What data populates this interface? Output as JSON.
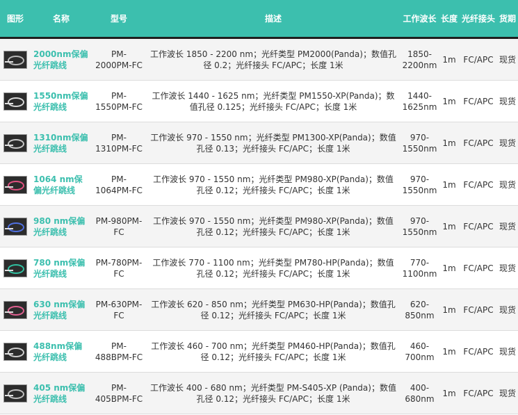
{
  "header": {
    "image": "图形",
    "name": "名称",
    "model": "型号",
    "desc": "描述",
    "wavelength": "工作波长",
    "length": "长度",
    "connector": "光纤接头",
    "stock": "货期"
  },
  "rows": [
    {
      "name": "2000nm保偏光纤跳线",
      "model": "PM-2000PM-FC",
      "desc": "工作波长 1850 - 2200 nm；光纤类型 PM2000(Panda)；数值孔径 0.2；光纤接头 FC/APC；长度 1米",
      "wavelength": "1850-2200nm",
      "length": "1m",
      "connector": "FC/APC",
      "stock": "现货",
      "fiber_color": "#b8b8b8"
    },
    {
      "name": "1550nm保偏光纤跳线",
      "model": "PM-1550PM-FC",
      "desc": "工作波长 1440 - 1625 nm；光纤类型 PM1550-XP(Panda)；数值孔径 0.125；光纤接头 FC/APC；长度 1米",
      "wavelength": "1440-1625nm",
      "length": "1m",
      "connector": "FC/APC",
      "stock": "现货",
      "fiber_color": "#d8d8d8"
    },
    {
      "name": "1310nm保偏光纤跳线",
      "model": "PM-1310PM-FC",
      "desc": "工作波长 970 - 1550 nm；光纤类型 PM1300-XP(Panda)；数值孔径 0.13；光纤接头 FC/APC；长度 1米",
      "wavelength": "970-1550nm",
      "length": "1m",
      "connector": "FC/APC",
      "stock": "现货",
      "fiber_color": "#c8c8c8"
    },
    {
      "name": "1064 nm保偏光纤跳线",
      "model": "PM-1064PM-FC",
      "desc": "工作波长 970 - 1550 nm；光纤类型 PM980-XP(Panda)；数值孔径 0.12；光纤接头 FC/APC；长度 1米",
      "wavelength": "970-1550nm",
      "length": "1m",
      "connector": "FC/APC",
      "stock": "现货",
      "fiber_color": "#e05080"
    },
    {
      "name": "980 nm保偏光纤跳线",
      "model": "PM-980PM-FC",
      "desc": "工作波长 970 - 1550 nm；光纤类型 PM980-XP(Panda)；数值孔径 0.12；光纤接头 FC/APC；长度 1米",
      "wavelength": "970-1550nm",
      "length": "1m",
      "connector": "FC/APC",
      "stock": "现货",
      "fiber_color": "#5070e0"
    },
    {
      "name": "780 nm保偏光纤跳线",
      "model": "PM-780PM-FC",
      "desc": "工作波长 770 - 1100 nm；光纤类型 PM780-HP(Panda)；数值孔径 0.12；光纤接头 FC/APC；长度 1米",
      "wavelength": "770-1100nm",
      "length": "1m",
      "connector": "FC/APC",
      "stock": "现货",
      "fiber_color": "#30c0a0"
    },
    {
      "name": "630 nm保偏光纤跳线",
      "model": "PM-630PM-FC",
      "desc": "工作波长 620 - 850 nm；光纤类型 PM630-HP(Panda)；数值孔径 0.12；光纤接头 FC/APC；长度 1米",
      "wavelength": "620-850nm",
      "length": "1m",
      "connector": "FC/APC",
      "stock": "现货",
      "fiber_color": "#e06090"
    },
    {
      "name": "488nm保偏光纤跳线",
      "model": "PM-488BPM-FC",
      "desc": "工作波长 460 - 700 nm；光纤类型 PM460-HP(Panda)；数值孔径 0.12；光纤接头 FC/APC；长度 1米",
      "wavelength": "460-700nm",
      "length": "1m",
      "connector": "FC/APC",
      "stock": "现货",
      "fiber_color": "#cfcfcf"
    },
    {
      "name": "405 nm保偏光纤跳线",
      "model": "PM-405BPM-FC",
      "desc": "工作波长 400 - 680 nm；光纤类型 PM-S405-XP (Panda)；数值孔径 0.12；光纤接头 FC/APC；长度 1米",
      "wavelength": "400-680nm",
      "length": "1m",
      "connector": "FC/APC",
      "stock": "现货",
      "fiber_color": "#bfbfbf"
    }
  ]
}
